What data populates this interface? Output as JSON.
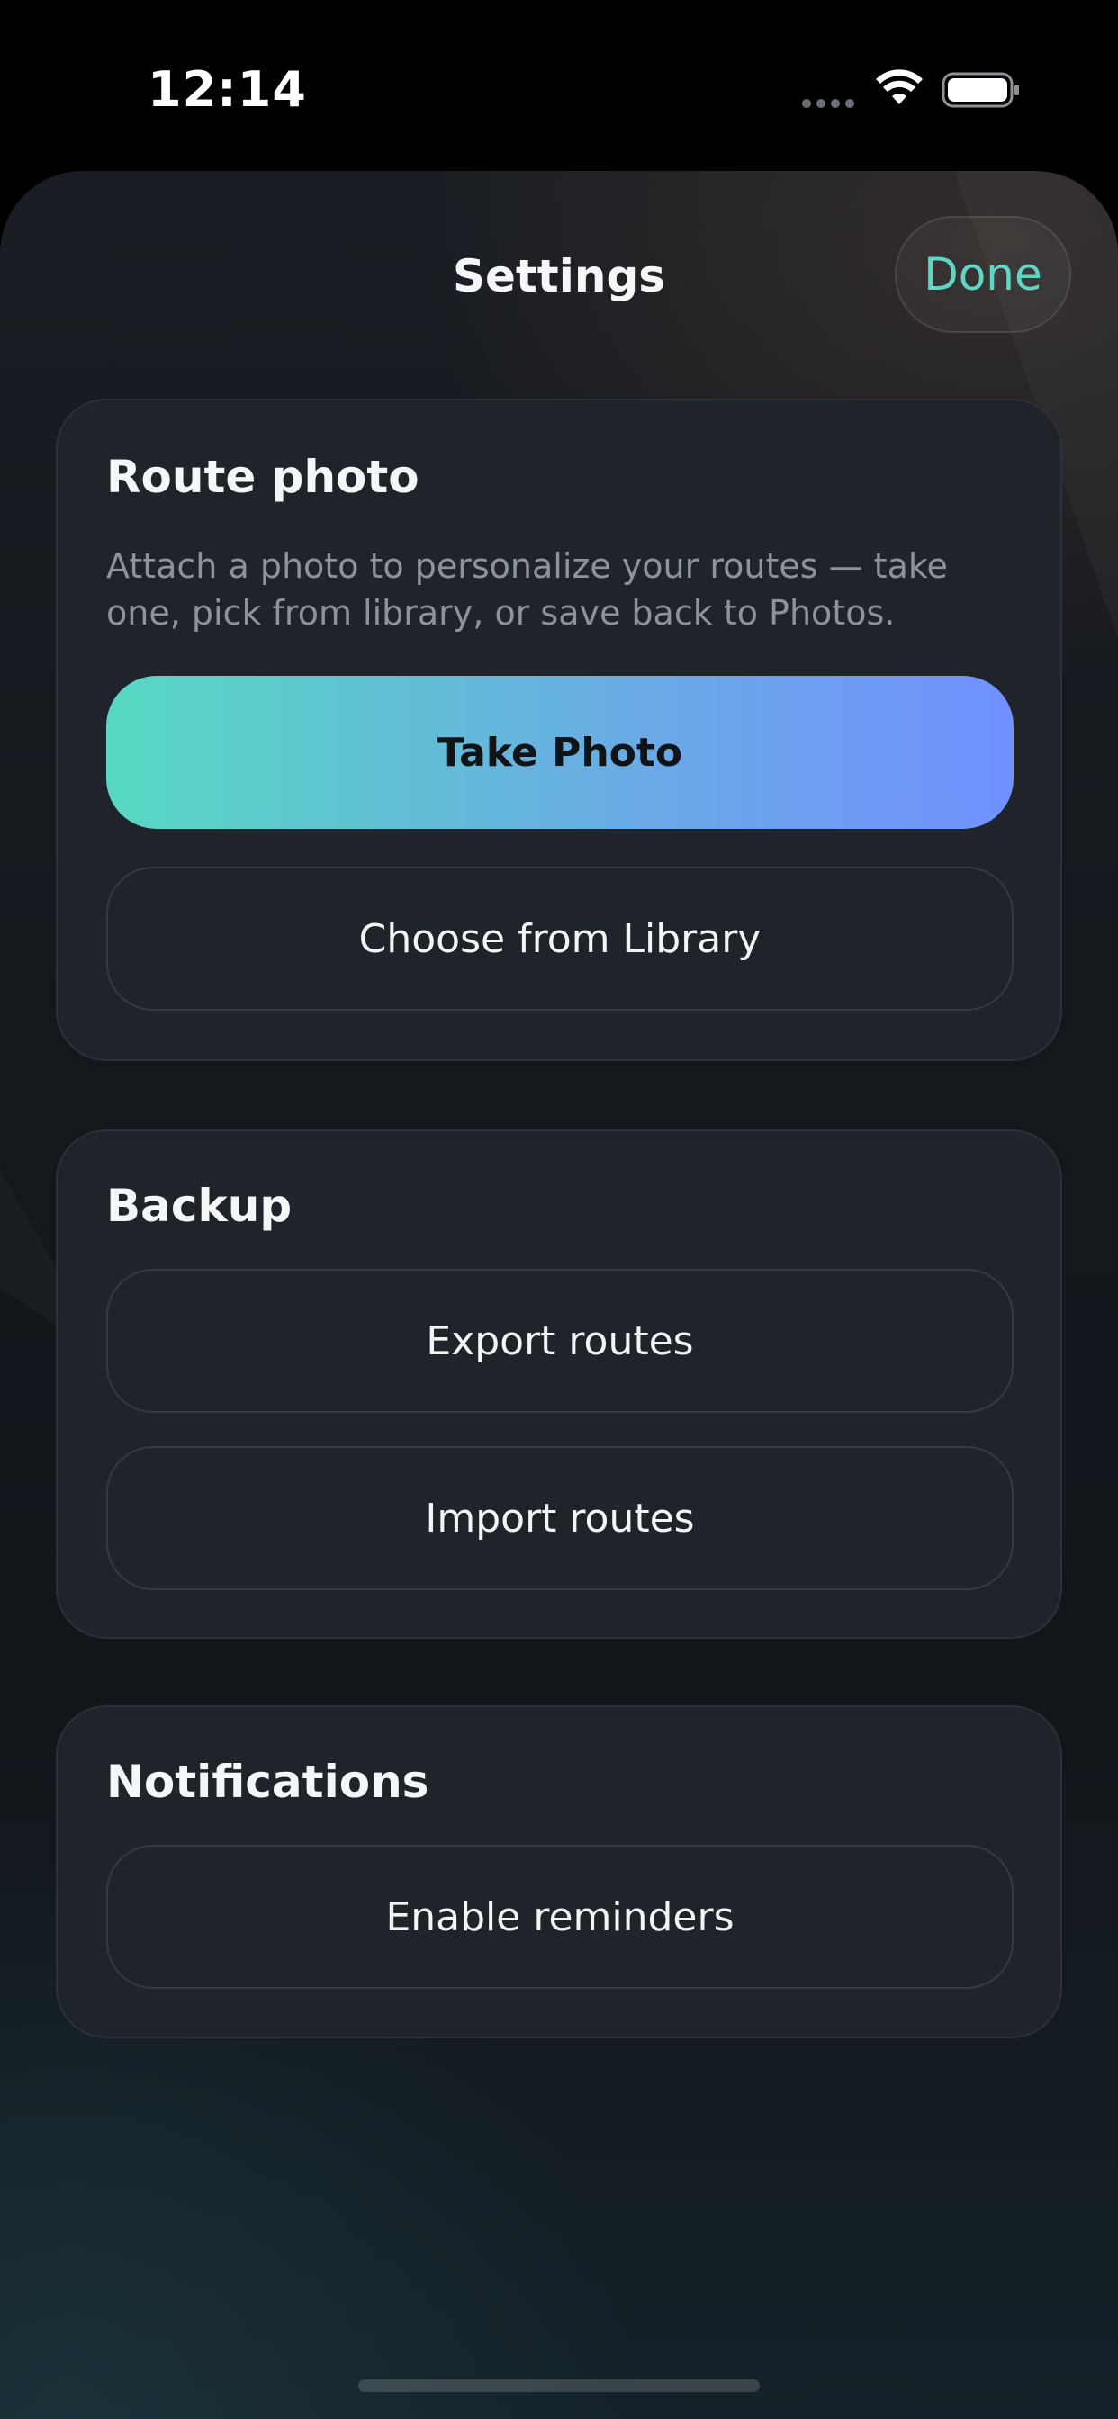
{
  "status_bar": {
    "time": "12:14"
  },
  "sheet": {
    "title": "Settings",
    "done_label": "Done",
    "accent_color": "#5fd6c4"
  },
  "route_photo": {
    "title": "Route photo",
    "description": "Attach a photo to personalize your routes — take one, pick from library, or save back to Photos.",
    "take_photo_label": "Take Photo",
    "choose_library_label": "Choose from Library"
  },
  "backup": {
    "title": "Backup",
    "export_label": "Export routes",
    "import_label": "Import routes"
  },
  "notifications": {
    "title": "Notifications",
    "enable_reminders_label": "Enable reminders"
  },
  "icons": {
    "wifi": "wifi-icon",
    "battery": "battery-icon",
    "signal": "signal-dots-icon"
  },
  "colors": {
    "primary_gradient_start": "#57d9c2",
    "primary_gradient_end": "#7191ff",
    "card_background": "#1f242b"
  }
}
